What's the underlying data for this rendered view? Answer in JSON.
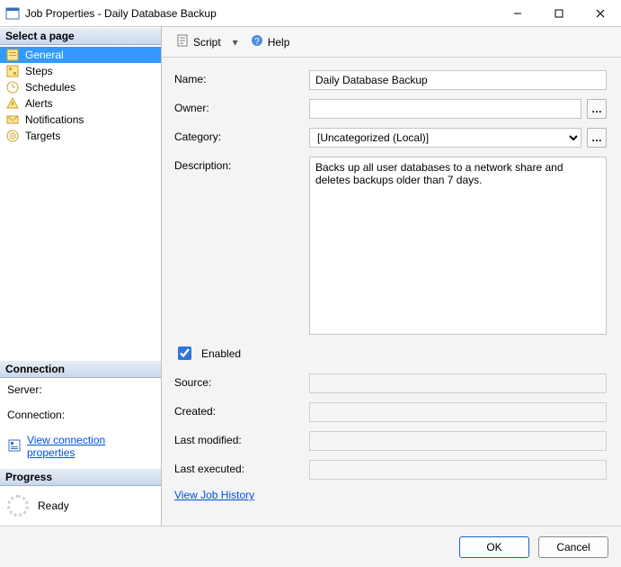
{
  "window": {
    "title": "Job Properties - Daily Database Backup"
  },
  "sidebar": {
    "header": "Select a page",
    "pages": [
      {
        "label": "General",
        "selected": true
      },
      {
        "label": "Steps",
        "selected": false
      },
      {
        "label": "Schedules",
        "selected": false
      },
      {
        "label": "Alerts",
        "selected": false
      },
      {
        "label": "Notifications",
        "selected": false
      },
      {
        "label": "Targets",
        "selected": false
      }
    ]
  },
  "connection": {
    "header": "Connection",
    "server_label": "Server:",
    "server_value": "",
    "connection_label": "Connection:",
    "connection_value": "",
    "link": "View connection properties"
  },
  "progress": {
    "header": "Progress",
    "status": "Ready"
  },
  "toolbar": {
    "script_label": "Script",
    "help_label": "Help"
  },
  "form": {
    "name_label": "Name:",
    "name_value": "Daily Database Backup",
    "owner_label": "Owner:",
    "owner_value": "",
    "category_label": "Category:",
    "category_value": "[Uncategorized (Local)]",
    "description_label": "Description:",
    "description_value": "Backs up all user databases to a network share and deletes backups older than 7 days.",
    "enabled_label": "Enabled",
    "enabled_checked": true,
    "source_label": "Source:",
    "source_value": "",
    "created_label": "Created:",
    "created_value": "",
    "modified_label": "Last modified:",
    "modified_value": "",
    "executed_label": "Last executed:",
    "executed_value": "",
    "history_link": "View Job History"
  },
  "footer": {
    "ok": "OK",
    "cancel": "Cancel"
  }
}
